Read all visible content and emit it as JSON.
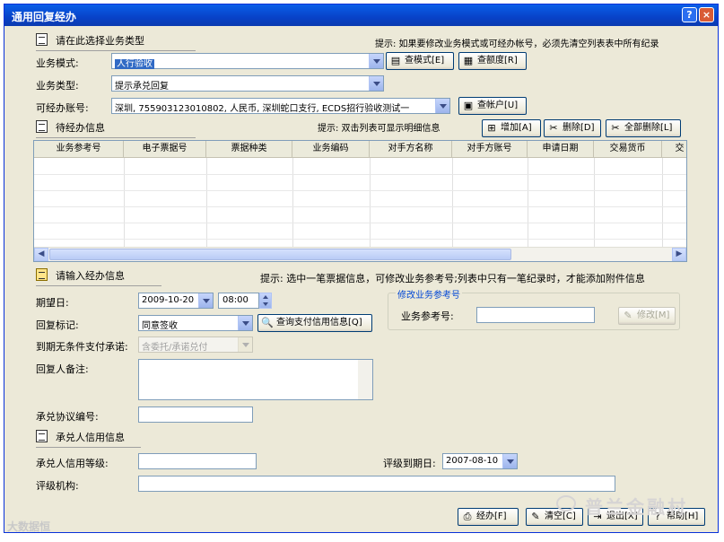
{
  "window": {
    "title": "通用回复经办",
    "help": "?",
    "close": "×"
  },
  "section_type": {
    "title": "请在此选择业务类型"
  },
  "hint_top": "提示: 如果要修改业务模式或可经办帐号，必须先清空列表表中所有纪录",
  "form_top": {
    "mode_label": "业务模式:",
    "mode_value": "人行验收",
    "btn_mode": "查模式[E]",
    "btn_quota": "查额度[R]",
    "type_label": "业务类型:",
    "type_value": "提示承兑回复",
    "account_label": "可经办账号:",
    "account_value": "深圳, 755903123010802, 人民币, 深圳蛇口支行, ECDS招行验收测试一",
    "btn_account": "查帐户[U]"
  },
  "section_pending": {
    "title": "待经办信息",
    "hint": "提示: 双击列表可显示明细信息"
  },
  "grid_buttons": {
    "add": "增加[A]",
    "delete": "删除[D]",
    "delete_all": "全部删除[L]"
  },
  "grid": {
    "columns": [
      "业务参考号",
      "电子票据号",
      "票据种类",
      "业务编码",
      "对手方名称",
      "对手方账号",
      "申请日期",
      "交易货币",
      "交"
    ],
    "rows": []
  },
  "section_input": {
    "title": "请输入经办信息",
    "hint": "提示: 选中一笔票据信息，可修改业务参考号;列表中只有一笔纪录时，才能添加附件信息"
  },
  "form_input": {
    "date_label": "期望日:",
    "date_value": "2009-10-20",
    "time_value": "08:00",
    "reply_label": "回复标记:",
    "reply_value": "同意签收",
    "btn_credit": "查询支付信用信息[Q]",
    "commit_label": "到期无条件支付承诺:",
    "commit_value": "含委托/承诺兑付",
    "remark_label": "回复人备注:",
    "remark_value": "",
    "protocol_label": "承兑协议编号:",
    "protocol_value": ""
  },
  "group_modify": {
    "legend": "修改业务参考号",
    "ref_label": "业务参考号:",
    "ref_value": "",
    "btn_modify": "修改[M]"
  },
  "section_credit": {
    "title": "承兑人信用信息"
  },
  "form_credit": {
    "grade_label": "承兑人信用等级:",
    "grade_value": "",
    "expire_label": "评级到期日:",
    "expire_value": "2007-08-10",
    "agency_label": "评级机构:",
    "agency_value": ""
  },
  "bottom_buttons": {
    "handle": "经办[F]",
    "clear": "清空[C]",
    "exit": "退出[X]",
    "help": "帮助[H]"
  },
  "watermarks": {
    "right": "普兰金融村",
    "left": "大数据恒"
  }
}
